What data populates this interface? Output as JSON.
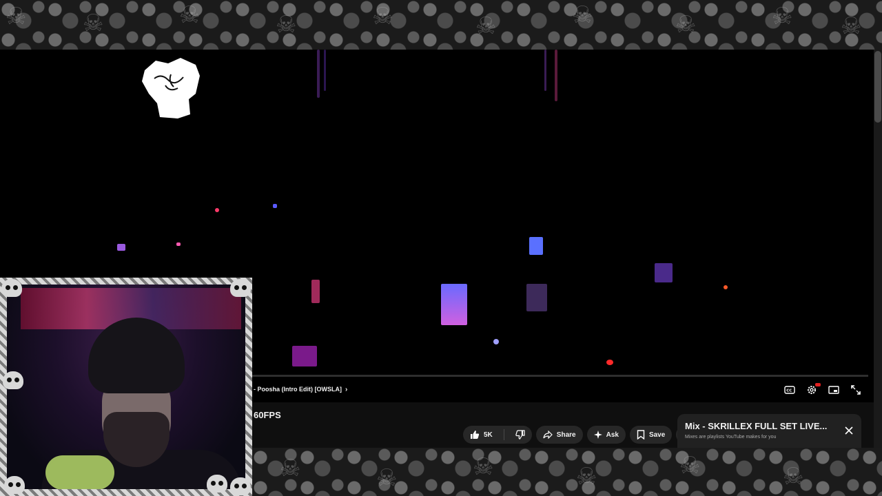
{
  "player": {
    "chapter_label": "- Poosha (Intro Edit) [OWSLA]",
    "chapter_chevron": "›",
    "controls": [
      "captions-button",
      "settings-button",
      "miniplayer-button",
      "fullscreen-button"
    ]
  },
  "video_info": {
    "title_fragment": "60FPS",
    "actions": {
      "like_count": "5K",
      "share_label": "Share",
      "ask_label": "Ask",
      "save_label": "Save",
      "more_label": "⋯"
    }
  },
  "mix_card": {
    "title": "Mix - SKRILLEX FULL SET LIVE...",
    "subtitle": "Mixes are playlists YouTube makes for you",
    "close_label": "✕"
  },
  "colors": {
    "page_bg": "#0f0f0f",
    "pill_bg": "#272727",
    "card_bg": "#212121",
    "hd_badge": "#e02020",
    "text_primary": "#f1f1f1",
    "text_secondary": "#aaaaaa"
  }
}
